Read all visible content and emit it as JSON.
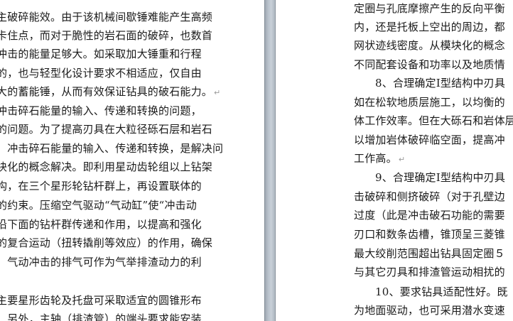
{
  "left_page": {
    "lines": [
      "主破碎能效。由于该机械间歇锤难能产生高频",
      "卡住点，而对于脆性的岩石面的破碎，也数首",
      "冲击的能量足够大。如采取加大锤重和行程",
      "的，也与轻型化设计要求不相适应，仅自由",
      "大的蓄能锤，从而有效保证钻具的破石能力。",
      "冲击碎石能量的输入、传递和转换的问题，",
      "的问题。为了提高刃具在大粒径砾石层和岩石",
      "，冲击碎石能量的输入、传递和转换，是解决问",
      "块化的概念解决。即利用星动齿轮组以上钻架",
      "构，在三个星形轮钻杆群上，再设置联体的",
      "的约束。压缩空气驱动“气动缸”使“冲击动",
      "沿下面的钻杆群传递和作用，以提高和强化",
      "的复合运动（扭转撬削等效应）的作用，确保",
      "，气动冲击的排气可作为气举排渣动力的利",
      "",
      "主要星形齿轮及托盘可采取适宜的圆锥形布",
      "。另外，主轴（排渣管）的端头要求能安装"
    ]
  },
  "right_page": {
    "lines": [
      "定圈与孔底摩擦产生的反向平衡",
      "内，还是托板上空出的周边，都",
      "网状迹线密度。从模块化的概念",
      "不同配套设备和功率以及地质情",
      "8、合理确定Ⅰ型结构中刃具",
      "如在松软地质层施工，以均衡的",
      "体工作效率。但在大砾石和岩体层",
      "以增加岩体破碎临空面，提高冲",
      "工作高。",
      "9、合理确定Ⅰ型结构中刃具",
      "击破碎和侧挤破碎（对于孔壁边",
      "过度（此是冲击破石功能的需要",
      "刃口和数条齿槽，锥顶呈三菱锥",
      "最大绞削范围超出钻具固定圈５",
      "与其它刃具和排渣管运动相扰的",
      "10、要求钻具适配性好。既",
      "为地面驱动，也可采用潜水变速"
    ],
    "paragraph_mark": "↵"
  }
}
